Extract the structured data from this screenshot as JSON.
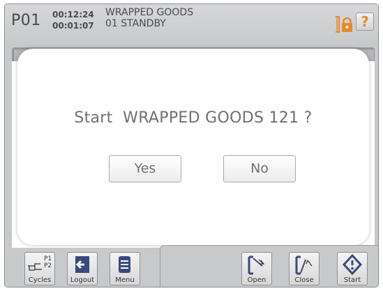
{
  "header": {
    "program_id": "P01",
    "elapsed_time": "00:12:24",
    "remaining_time": "00:01:07",
    "program_name": "WRAPPED GOODS",
    "status": "01 STANDBY",
    "help_label": "?"
  },
  "dialog": {
    "message": "Start  WRAPPED GOODS 121 ?",
    "yes_label": "Yes",
    "no_label": "No"
  },
  "toolbar": {
    "cycles_label": "Cycles",
    "cycles_p1": "P1",
    "cycles_p2": "P2",
    "logout_label": "Logout",
    "menu_label": "Menu",
    "open_label": "Open",
    "close_label": "Close",
    "start_label": "Start"
  },
  "colors": {
    "accent_orange": "#e88a2a",
    "frame_gray": "#c8c9cb",
    "icon_blue": "#3b4a7a"
  }
}
